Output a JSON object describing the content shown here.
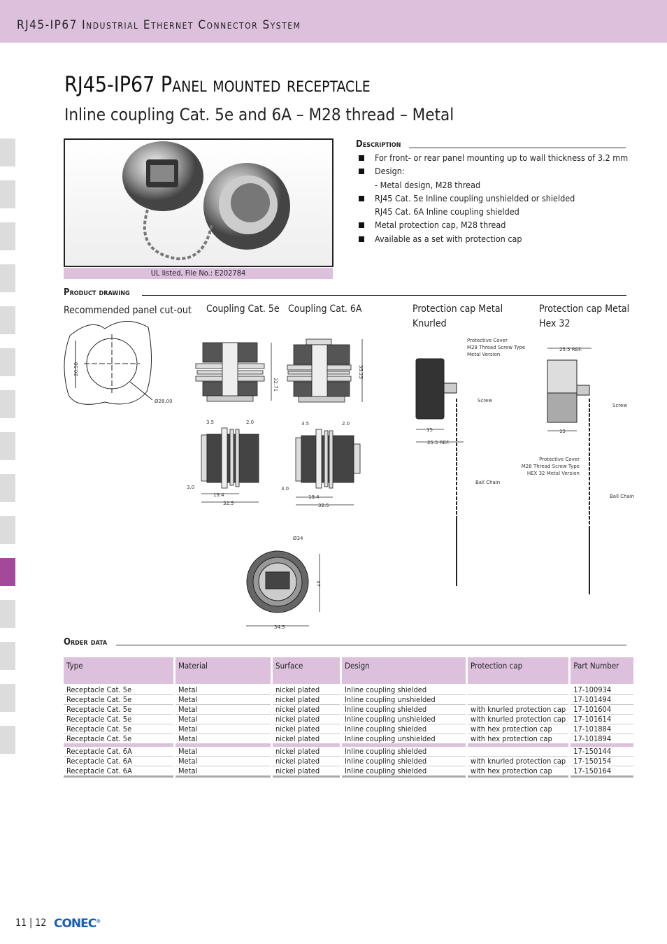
{
  "header": {
    "title": "RJ45-IP67 Industrial Ethernet Connector System"
  },
  "page": {
    "title": "RJ45-IP67 Panel mounted receptacle",
    "subtitle": "Inline coupling Cat. 5e and 6A – M28 thread – Metal"
  },
  "photo": {
    "caption": "UL listed, File No.: E202784"
  },
  "description": {
    "heading": "Description",
    "items": [
      {
        "text": "For front- or rear panel mounting up to wall thickness of 3.2 mm",
        "bullet": true
      },
      {
        "text": "Design:",
        "bullet": true
      },
      {
        "text": "- Metal design, M28 thread",
        "bullet": false
      },
      {
        "text": "RJ45 Cat. 5e Inline coupling unshielded or shielded",
        "bullet": true
      },
      {
        "text": "RJ45 Cat. 6A Inline coupling shielded",
        "bullet": false
      },
      {
        "text": "Metal protection cap, M28 thread",
        "bullet": true
      },
      {
        "text": "Available as a set with protection cap",
        "bullet": true
      }
    ]
  },
  "drawing": {
    "heading": "Product drawing",
    "labels": {
      "cutout": "Recommended panel cut-out",
      "cat5e": "Coupling Cat. 5e",
      "cat6a": "Coupling Cat. 6A",
      "knurled": "Protection cap Metal Knurled",
      "hex": "Protection cap Metal Hex 32"
    },
    "dims": {
      "cut_h": "26.50",
      "cut_d": "Ø28.00",
      "h5e": "32.71",
      "h6a": "35.25",
      "d35": "3.5",
      "d20": "2.0",
      "d30": "3.0",
      "d194": "19.4",
      "d325": "32.5",
      "phi34": "Ø34",
      "w345": "34.5",
      "h37": "37",
      "cap15": "15",
      "ref": "25.5 REF."
    },
    "callouts": {
      "cover1": "Protective Cover",
      "cover2": "M28 Thread Screw Type",
      "cover3k": "Metal Version",
      "cover3h": "HEX 32 Metal Version",
      "screw": "Screw",
      "chain": "Ball Chain"
    }
  },
  "order": {
    "heading": "Order data",
    "columns": [
      "Type",
      "Material",
      "Surface",
      "Design",
      "Protection cap",
      "Part Number"
    ],
    "rows": [
      [
        "Receptacle Cat. 5e",
        "Metal",
        "nickel plated",
        "Inline coupling shielded",
        "",
        "17-100934"
      ],
      [
        "Receptacle Cat. 5e",
        "Metal",
        "nickel plated",
        "Inline coupling unshielded",
        "",
        "17-101494"
      ],
      [
        "Receptacle Cat. 5e",
        "Metal",
        "nickel plated",
        "Inline coupling shielded",
        "with knurled protection cap",
        "17-101604"
      ],
      [
        "Receptacle Cat. 5e",
        "Metal",
        "nickel plated",
        "Inline coupling unshielded",
        "with knurled protection cap",
        "17-101614"
      ],
      [
        "Receptacle Cat. 5e",
        "Metal",
        "nickel plated",
        "Inline coupling shielded",
        "with hex protection cap",
        "17-101884"
      ],
      [
        "Receptacle Cat. 5e",
        "Metal",
        "nickel plated",
        "Inline coupling unshielded",
        "with hex protection cap",
        "17-101894"
      ],
      [
        "Receptacle Cat. 6A",
        "Metal",
        "nickel plated",
        "Inline coupling shielded",
        "",
        "17-150144"
      ],
      [
        "Receptacle Cat. 6A",
        "Metal",
        "nickel plated",
        "Inline coupling shielded",
        "with knurled protection cap",
        "17-150154"
      ],
      [
        "Receptacle Cat. 6A",
        "Metal",
        "nickel plated",
        "Inline coupling shielded",
        "with hex protection cap",
        "17-150164"
      ]
    ]
  },
  "footer": {
    "pages": "11 | 12",
    "logo": "CONEC"
  },
  "colors": {
    "accent": "#dcc0dc",
    "active_tab": "#a4489c",
    "logo": "#1a5fb4"
  }
}
